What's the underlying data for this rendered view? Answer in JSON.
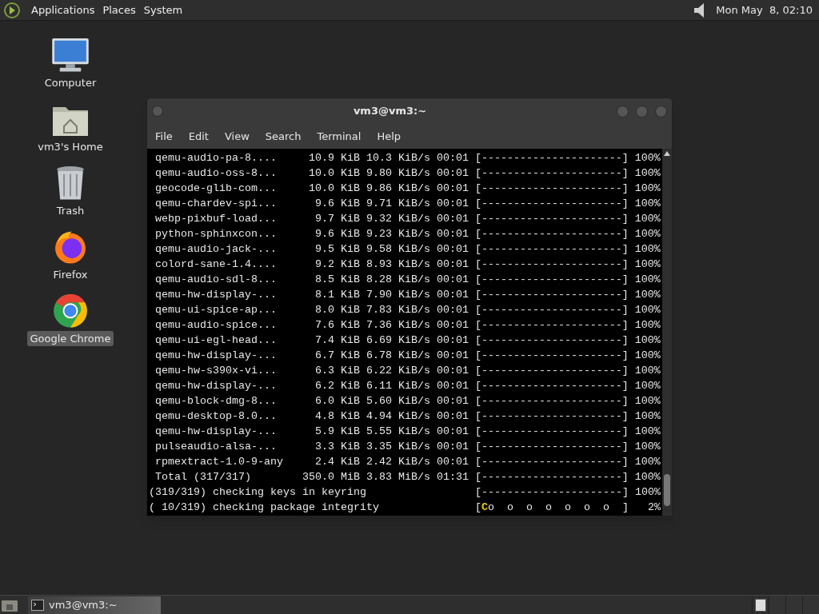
{
  "top_panel": {
    "menus": [
      "Applications",
      "Places",
      "System"
    ],
    "clock": "Mon May  8, 02:10"
  },
  "desktop_icons": [
    {
      "kind": "computer",
      "label": "Computer",
      "selected": false
    },
    {
      "kind": "home",
      "label": "vm3's Home",
      "selected": false
    },
    {
      "kind": "trash",
      "label": "Trash",
      "selected": false
    },
    {
      "kind": "firefox",
      "label": "Firefox",
      "selected": false
    },
    {
      "kind": "chrome",
      "label": "Google Chrome",
      "selected": true
    }
  ],
  "terminal": {
    "title": "vm3@vm3:~",
    "menus": [
      "File",
      "Edit",
      "View",
      "Search",
      "Terminal",
      "Help"
    ],
    "lines": [
      {
        "kind": "download",
        "name": "qemu-audio-pa-8....",
        "size": "10.9 KiB",
        "speed": "10.3 KiB/s",
        "time": "00:01",
        "bar": "[----------------------]",
        "percent": "100%"
      },
      {
        "kind": "download",
        "name": "qemu-audio-oss-8...",
        "size": "10.0 KiB",
        "speed": "9.80 KiB/s",
        "time": "00:01",
        "bar": "[----------------------]",
        "percent": "100%"
      },
      {
        "kind": "download",
        "name": "geocode-glib-com...",
        "size": "10.0 KiB",
        "speed": "9.86 KiB/s",
        "time": "00:01",
        "bar": "[----------------------]",
        "percent": "100%"
      },
      {
        "kind": "download",
        "name": "qemu-chardev-spi...",
        "size": "9.6 KiB",
        "speed": "9.71 KiB/s",
        "time": "00:01",
        "bar": "[----------------------]",
        "percent": "100%"
      },
      {
        "kind": "download",
        "name": "webp-pixbuf-load...",
        "size": "9.7 KiB",
        "speed": "9.32 KiB/s",
        "time": "00:01",
        "bar": "[----------------------]",
        "percent": "100%"
      },
      {
        "kind": "download",
        "name": "python-sphinxcon...",
        "size": "9.6 KiB",
        "speed": "9.23 KiB/s",
        "time": "00:01",
        "bar": "[----------------------]",
        "percent": "100%"
      },
      {
        "kind": "download",
        "name": "qemu-audio-jack-...",
        "size": "9.5 KiB",
        "speed": "9.58 KiB/s",
        "time": "00:01",
        "bar": "[----------------------]",
        "percent": "100%"
      },
      {
        "kind": "download",
        "name": "colord-sane-1.4....",
        "size": "9.2 KiB",
        "speed": "8.93 KiB/s",
        "time": "00:01",
        "bar": "[----------------------]",
        "percent": "100%"
      },
      {
        "kind": "download",
        "name": "qemu-audio-sdl-8...",
        "size": "8.5 KiB",
        "speed": "8.28 KiB/s",
        "time": "00:01",
        "bar": "[----------------------]",
        "percent": "100%"
      },
      {
        "kind": "download",
        "name": "qemu-hw-display-...",
        "size": "8.1 KiB",
        "speed": "7.90 KiB/s",
        "time": "00:01",
        "bar": "[----------------------]",
        "percent": "100%"
      },
      {
        "kind": "download",
        "name": "qemu-ui-spice-ap...",
        "size": "8.0 KiB",
        "speed": "7.83 KiB/s",
        "time": "00:01",
        "bar": "[----------------------]",
        "percent": "100%"
      },
      {
        "kind": "download",
        "name": "qemu-audio-spice...",
        "size": "7.6 KiB",
        "speed": "7.36 KiB/s",
        "time": "00:01",
        "bar": "[----------------------]",
        "percent": "100%"
      },
      {
        "kind": "download",
        "name": "qemu-ui-egl-head...",
        "size": "7.4 KiB",
        "speed": "6.69 KiB/s",
        "time": "00:01",
        "bar": "[----------------------]",
        "percent": "100%"
      },
      {
        "kind": "download",
        "name": "qemu-hw-display-...",
        "size": "6.7 KiB",
        "speed": "6.78 KiB/s",
        "time": "00:01",
        "bar": "[----------------------]",
        "percent": "100%"
      },
      {
        "kind": "download",
        "name": "qemu-hw-s390x-vi...",
        "size": "6.3 KiB",
        "speed": "6.22 KiB/s",
        "time": "00:01",
        "bar": "[----------------------]",
        "percent": "100%"
      },
      {
        "kind": "download",
        "name": "qemu-hw-display-...",
        "size": "6.2 KiB",
        "speed": "6.11 KiB/s",
        "time": "00:01",
        "bar": "[----------------------]",
        "percent": "100%"
      },
      {
        "kind": "download",
        "name": "qemu-block-dmg-8...",
        "size": "6.0 KiB",
        "speed": "5.60 KiB/s",
        "time": "00:01",
        "bar": "[----------------------]",
        "percent": "100%"
      },
      {
        "kind": "download",
        "name": "qemu-desktop-8.0...",
        "size": "4.8 KiB",
        "speed": "4.94 KiB/s",
        "time": "00:01",
        "bar": "[----------------------]",
        "percent": "100%"
      },
      {
        "kind": "download",
        "name": "qemu-hw-display-...",
        "size": "5.9 KiB",
        "speed": "5.55 KiB/s",
        "time": "00:01",
        "bar": "[----------------------]",
        "percent": "100%"
      },
      {
        "kind": "download",
        "name": "pulseaudio-alsa-...",
        "size": "3.3 KiB",
        "speed": "3.35 KiB/s",
        "time": "00:01",
        "bar": "[----------------------]",
        "percent": "100%"
      },
      {
        "kind": "download",
        "name": "rpmextract-1.0-9-any",
        "size": "2.4 KiB",
        "speed": "2.42 KiB/s",
        "time": "00:01",
        "bar": "[----------------------]",
        "percent": "100%"
      },
      {
        "kind": "download",
        "name": "Total (317/317)",
        "size": "350.0 MiB",
        "speed": "3.83 MiB/s",
        "time": "01:31",
        "bar": "[----------------------]",
        "percent": "100%"
      },
      {
        "kind": "check",
        "label": "(319/319) checking keys in keyring",
        "bar": [
          {
            "text": "[----------------------]",
            "highlight": false
          }
        ],
        "percent": "100%"
      },
      {
        "kind": "check",
        "label": "( 10/319) checking package integrity",
        "bar": [
          {
            "text": "[",
            "highlight": false
          },
          {
            "text": "C",
            "highlight": true
          },
          {
            "text": "o  o  o  o  o  o  o  ]",
            "highlight": false
          }
        ],
        "percent": "2%"
      }
    ]
  },
  "taskbar": {
    "tasks": [
      {
        "label": "vm3@vm3:~",
        "selected": false
      }
    ],
    "workspaces": [
      {
        "selected": true
      },
      {
        "selected": false
      },
      {
        "selected": false
      },
      {
        "selected": false
      }
    ]
  }
}
